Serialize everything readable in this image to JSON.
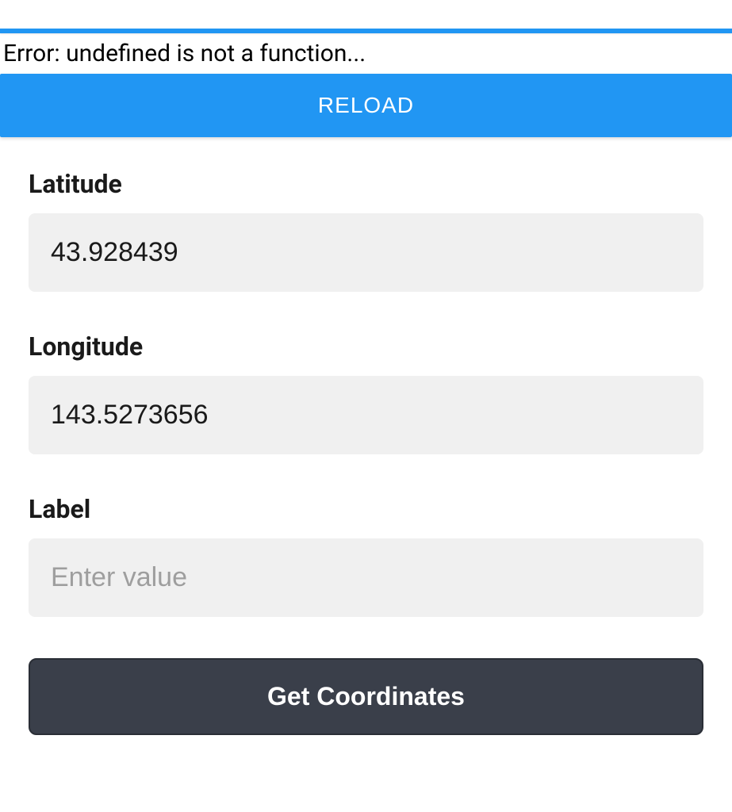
{
  "error": {
    "message": "Error: undefined is not a function..."
  },
  "reload": {
    "label": "RELOAD"
  },
  "form": {
    "latitude": {
      "label": "Latitude",
      "value": "43.928439"
    },
    "longitude": {
      "label": "Longitude",
      "value": "143.5273656"
    },
    "labelField": {
      "label": "Label",
      "placeholder": "Enter value",
      "value": ""
    },
    "submit": {
      "label": "Get Coordinates"
    }
  }
}
